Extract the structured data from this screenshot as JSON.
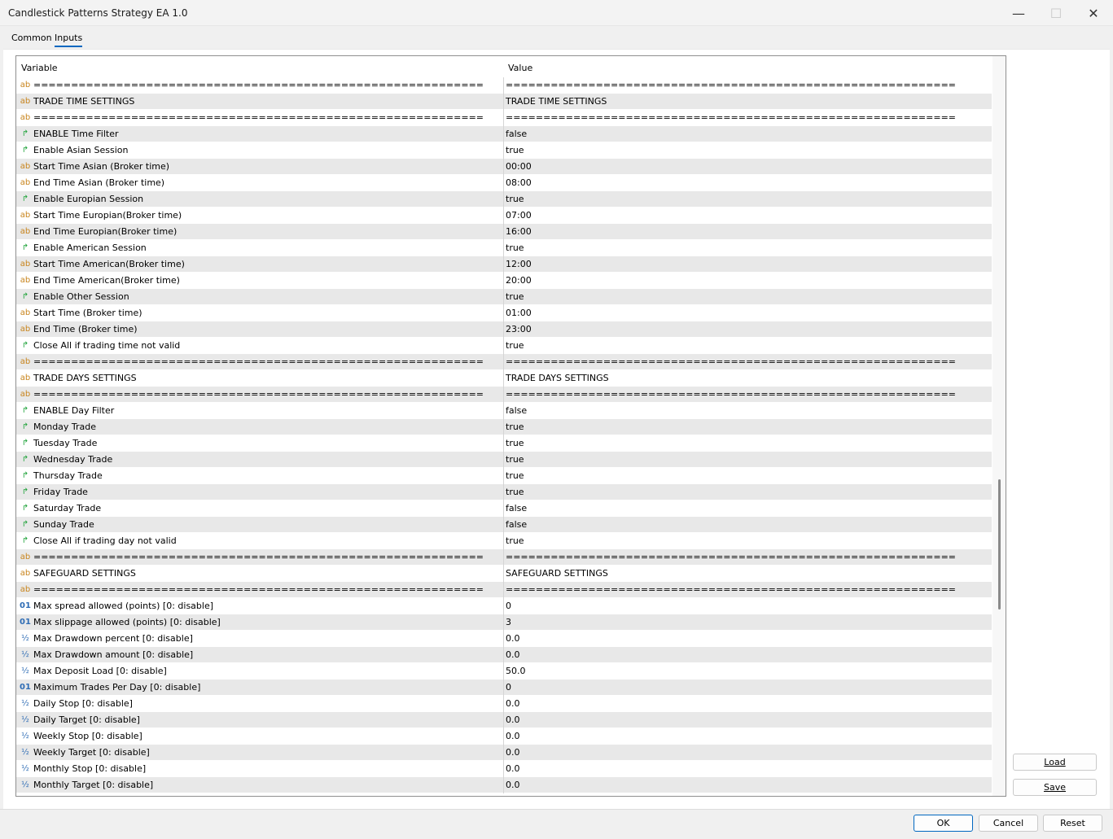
{
  "window": {
    "title": "Candlestick Patterns Strategy EA 1.0",
    "minimize_glyph": "—",
    "maximize_glyph": "☐",
    "close_glyph": "✕"
  },
  "tabs": [
    {
      "label": "Common",
      "active": false
    },
    {
      "label": "Inputs",
      "active": true
    }
  ],
  "grid": {
    "col_variable": "Variable",
    "col_value": "Value",
    "rows": [
      {
        "icon": "ab",
        "name": "============================================================",
        "value": "============================================================"
      },
      {
        "icon": "ab",
        "name": "TRADE TIME SETTINGS",
        "value": "TRADE TIME SETTINGS"
      },
      {
        "icon": "ab",
        "name": "============================================================",
        "value": "============================================================"
      },
      {
        "icon": "bool",
        "name": "ENABLE Time Filter",
        "value": "false"
      },
      {
        "icon": "bool",
        "name": "Enable Asian Session",
        "value": "true"
      },
      {
        "icon": "ab",
        "name": "Start Time Asian (Broker time)",
        "value": "00:00"
      },
      {
        "icon": "ab",
        "name": "End Time Asian (Broker time)",
        "value": "08:00"
      },
      {
        "icon": "bool",
        "name": "Enable Europian Session",
        "value": "true"
      },
      {
        "icon": "ab",
        "name": "Start Time Europian(Broker time)",
        "value": "07:00"
      },
      {
        "icon": "ab",
        "name": "End Time Europian(Broker time)",
        "value": "16:00"
      },
      {
        "icon": "bool",
        "name": "Enable American Session",
        "value": "true"
      },
      {
        "icon": "ab",
        "name": "Start Time American(Broker time)",
        "value": "12:00"
      },
      {
        "icon": "ab",
        "name": "End Time American(Broker time)",
        "value": "20:00"
      },
      {
        "icon": "bool",
        "name": "Enable Other Session",
        "value": "true"
      },
      {
        "icon": "ab",
        "name": "Start Time (Broker time)",
        "value": "01:00"
      },
      {
        "icon": "ab",
        "name": "End Time (Broker time)",
        "value": "23:00"
      },
      {
        "icon": "bool",
        "name": "Close All if trading time not valid",
        "value": "true"
      },
      {
        "icon": "ab",
        "name": "============================================================",
        "value": "============================================================"
      },
      {
        "icon": "ab",
        "name": "TRADE DAYS SETTINGS",
        "value": "TRADE DAYS SETTINGS"
      },
      {
        "icon": "ab",
        "name": "============================================================",
        "value": "============================================================"
      },
      {
        "icon": "bool",
        "name": "ENABLE Day Filter",
        "value": "false"
      },
      {
        "icon": "bool",
        "name": "Monday Trade",
        "value": "true"
      },
      {
        "icon": "bool",
        "name": "Tuesday Trade",
        "value": "true"
      },
      {
        "icon": "bool",
        "name": "Wednesday Trade",
        "value": "true"
      },
      {
        "icon": "bool",
        "name": "Thursday Trade",
        "value": "true"
      },
      {
        "icon": "bool",
        "name": "Friday Trade",
        "value": "true"
      },
      {
        "icon": "bool",
        "name": "Saturday Trade",
        "value": "false"
      },
      {
        "icon": "bool",
        "name": "Sunday Trade",
        "value": "false"
      },
      {
        "icon": "bool",
        "name": "Close All if trading day not valid",
        "value": "true"
      },
      {
        "icon": "ab",
        "name": "============================================================",
        "value": "============================================================"
      },
      {
        "icon": "ab",
        "name": "SAFEGUARD SETTINGS",
        "value": "SAFEGUARD SETTINGS"
      },
      {
        "icon": "ab",
        "name": "============================================================",
        "value": "============================================================"
      },
      {
        "icon": "int",
        "name": "Max spread allowed (points) [0: disable]",
        "value": "0"
      },
      {
        "icon": "int",
        "name": "Max slippage allowed (points) [0: disable]",
        "value": "3"
      },
      {
        "icon": "dbl",
        "name": "Max Drawdown percent [0: disable]",
        "value": "0.0"
      },
      {
        "icon": "dbl",
        "name": "Max Drawdown amount [0: disable]",
        "value": "0.0"
      },
      {
        "icon": "dbl",
        "name": "Max Deposit Load [0: disable]",
        "value": "50.0"
      },
      {
        "icon": "int",
        "name": "Maximum Trades Per Day [0: disable]",
        "value": "0"
      },
      {
        "icon": "dbl",
        "name": "Daily Stop [0: disable]",
        "value": "0.0"
      },
      {
        "icon": "dbl",
        "name": "Daily Target [0: disable]",
        "value": "0.0"
      },
      {
        "icon": "dbl",
        "name": "Weekly Stop [0: disable]",
        "value": "0.0"
      },
      {
        "icon": "dbl",
        "name": "Weekly Target [0: disable]",
        "value": "0.0"
      },
      {
        "icon": "dbl",
        "name": "Monthly Stop [0: disable]",
        "value": "0.0"
      },
      {
        "icon": "dbl",
        "name": "Monthly Target [0: disable]",
        "value": "0.0"
      }
    ]
  },
  "icons": {
    "ab": {
      "glyph": "ab",
      "name": "string-type-icon"
    },
    "bool": {
      "glyph": "↱",
      "name": "bool-type-icon"
    },
    "int": {
      "glyph": "01",
      "name": "integer-type-icon"
    },
    "dbl": {
      "glyph": "½",
      "name": "double-type-icon"
    }
  },
  "side_buttons": {
    "load_label": "Load",
    "save_label": "Save"
  },
  "footer_buttons": {
    "ok_label": "OK",
    "cancel_label": "Cancel",
    "reset_label": "Reset"
  }
}
